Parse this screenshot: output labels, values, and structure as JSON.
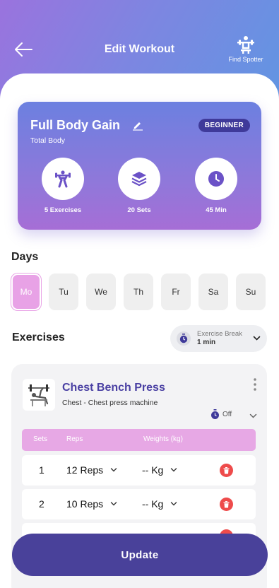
{
  "header": {
    "title": "Edit Workout",
    "spotter_label": "Find Spotter",
    "colors": {
      "gradient_start": "#9a73de",
      "gradient_end": "#5e97e2"
    }
  },
  "workout": {
    "name": "Full Body Gain",
    "target": "Total Body",
    "level": "BEGINNER",
    "stats": [
      {
        "icon": "dumbbell-icon",
        "label": "5 Exercises"
      },
      {
        "icon": "layers-icon",
        "label": "20 Sets"
      },
      {
        "icon": "clock-icon",
        "label": "45 Min"
      }
    ]
  },
  "days": {
    "title": "Days",
    "items": [
      "Mo",
      "Tu",
      "We",
      "Th",
      "Fr",
      "Sa",
      "Su"
    ],
    "selected": "Mo"
  },
  "exercises": {
    "title": "Exercises",
    "break_label": "Exercise Break",
    "break_value": "1 min",
    "card": {
      "name": "Chest Bench Press",
      "description": "Chest - Chest press machine",
      "timer_state": "Off",
      "columns": {
        "sets": "Sets",
        "reps": "Reps",
        "weights": "Weights (kg)"
      },
      "rows": [
        {
          "set": "1",
          "reps": "12 Reps",
          "weight": "-- Kg"
        },
        {
          "set": "2",
          "reps": "10 Reps",
          "weight": "-- Kg"
        }
      ]
    }
  },
  "actions": {
    "update_label": "Update"
  },
  "theme": {
    "accent": "#49419a",
    "pink": "#e7a8e5",
    "danger": "#ee4b4b"
  }
}
